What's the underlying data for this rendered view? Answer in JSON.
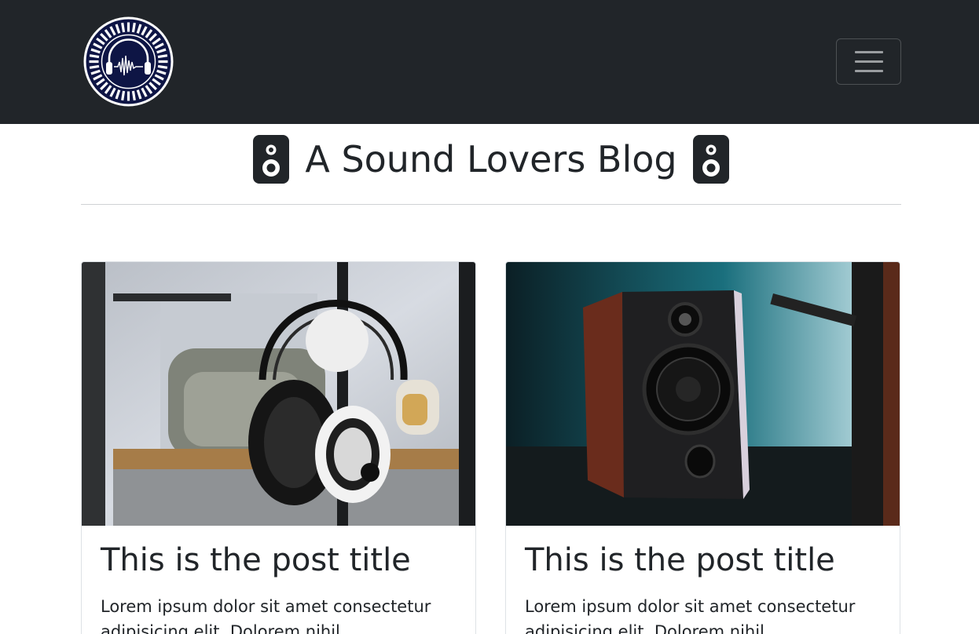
{
  "navbar": {
    "logo_alt": "Sound Lovers logo",
    "toggle_label": "Toggle navigation",
    "colors": {
      "background": "#212529",
      "logo_navy": "#0e1545"
    }
  },
  "header": {
    "title": "A Sound Lovers Blog",
    "leading_icon": "speaker-icon",
    "trailing_icon": "speaker-icon"
  },
  "posts": [
    {
      "image": "headphones-photo",
      "title": "This is the post title",
      "excerpt": "Lorem ipsum dolor sit amet consectetur adipisicing elit. Dolorem nihil"
    },
    {
      "image": "bookshelf-speaker-photo",
      "title": "This is the post title",
      "excerpt": "Lorem ipsum dolor sit amet consectetur adipisicing elit. Dolorem nihil"
    }
  ]
}
